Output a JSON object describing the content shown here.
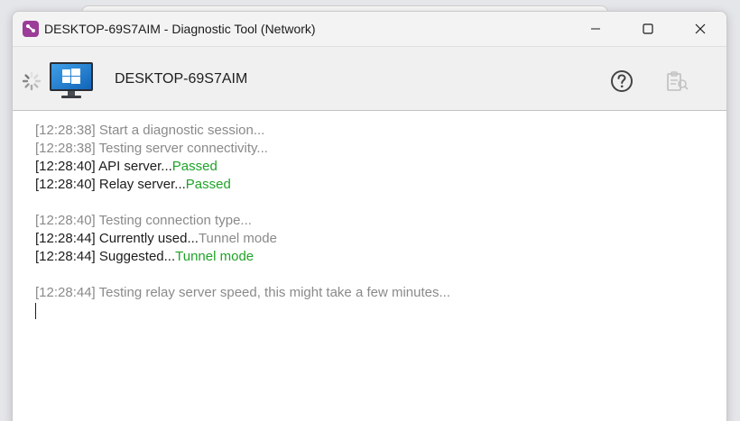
{
  "window": {
    "title": "DESKTOP-69S7AIM - Diagnostic Tool (Network)",
    "controls": [
      "minimize",
      "maximize",
      "close"
    ],
    "accent": "#9b3c98"
  },
  "toolbar": {
    "hostname": "DESKTOP-69S7AIM",
    "icons": [
      "loading-spinner-icon",
      "windows-monitor-icon",
      "help-icon",
      "report-clipboard-icon"
    ]
  },
  "log": {
    "lines": [
      {
        "time": "[12:28:38]",
        "text": "Start a diagnostic session...",
        "result": ""
      },
      {
        "time": "[12:28:38]",
        "text": "Testing server connectivity...",
        "result": ""
      },
      {
        "time": "[12:28:40]",
        "text": "API server...",
        "result": "Passed"
      },
      {
        "time": "[12:28:40]",
        "text": "Relay server...",
        "result": "Passed"
      },
      {
        "time": "[12:28:40]",
        "text": "Testing connection type...",
        "result": ""
      },
      {
        "time": "[12:28:44]",
        "text": "Currently used...",
        "result": "Tunnel mode"
      },
      {
        "time": "[12:28:44]",
        "text": "Suggested...",
        "result": "Tunnel mode"
      },
      {
        "time": "[12:28:44]",
        "text": "Testing relay server speed, this might take a few minutes...",
        "result": ""
      }
    ],
    "colors": {
      "muted": "#8a8a8a",
      "normal": "#1c1c1c",
      "passed": "#1fa328"
    }
  }
}
